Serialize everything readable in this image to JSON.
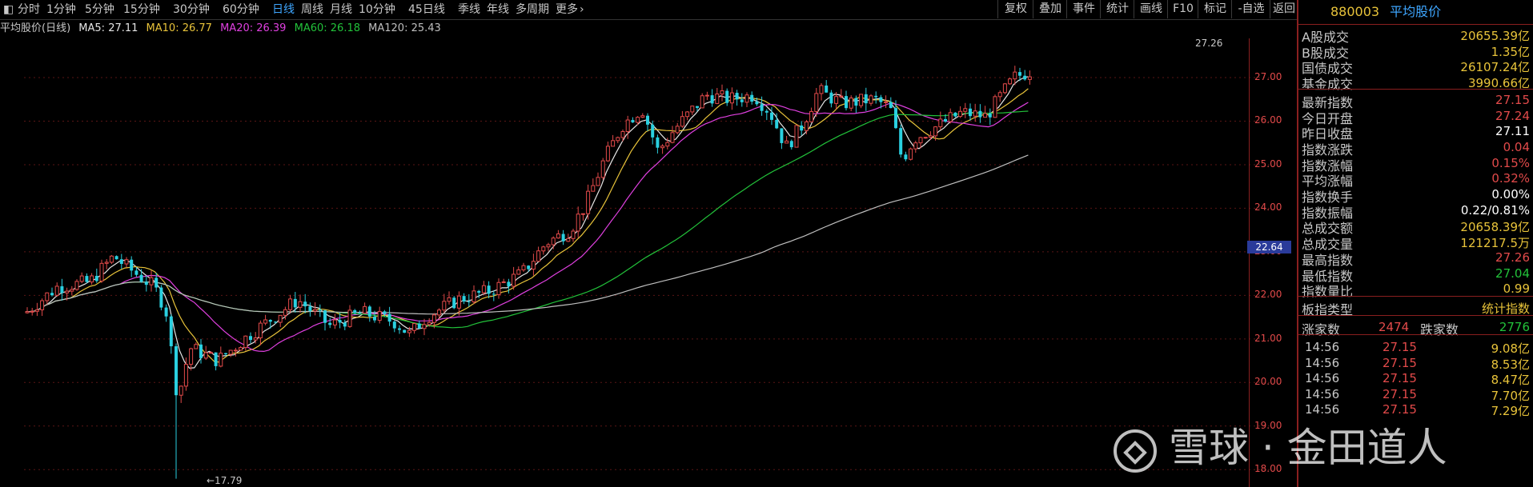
{
  "toolbar": {
    "periods": [
      "分时",
      "1分钟",
      "5分钟",
      "15分钟",
      "30分钟",
      "60分钟",
      "日线",
      "周线",
      "月线",
      "10分钟",
      "45日线",
      "季线",
      "年线",
      "多周期",
      "更多"
    ],
    "active_period": "日线",
    "buttons": [
      "复权",
      "叠加",
      "事件",
      "统计",
      "画线",
      "F10",
      "标记",
      "-自选",
      "返回"
    ]
  },
  "indicator_bar": {
    "title": "平均股价(日线)",
    "ma5": "MA5: 27.11",
    "ma10": "MA10: 26.77",
    "ma20": "MA20: 26.39",
    "ma60": "MA60: 26.18",
    "ma120": "MA120: 25.43"
  },
  "colors": {
    "up": "#e24a4a",
    "down": "#2ad0e0",
    "ma5": "#e6e6e6",
    "ma10": "#e8c33a",
    "ma20": "#e040e0",
    "ma60": "#22c23a",
    "ma120": "#bfbfbf",
    "accent": "#3ea6ff"
  },
  "chart": {
    "high_marker": "27.26",
    "low_marker": "←17.79",
    "current_price": "22.64"
  },
  "chart_data": {
    "type": "candlestick",
    "y_ticks": [
      "27.00",
      "26.00",
      "25.00",
      "24.00",
      "23.00",
      "22.00",
      "21.00",
      "20.00",
      "19.00",
      "18.00"
    ],
    "ylim": [
      17.6,
      27.9
    ],
    "high": 27.26,
    "low": 17.79
  },
  "panel": {
    "code": "880003",
    "name": "平均股价",
    "rows": [
      {
        "k": "A股成交",
        "v": "20655.39亿",
        "c": "#e8c33a"
      },
      {
        "k": "B股成交",
        "v": "1.35亿",
        "c": "#e8c33a"
      },
      {
        "k": "国债成交",
        "v": "26107.24亿",
        "c": "#e8c33a"
      },
      {
        "k": "基金成交",
        "v": "3990.66亿",
        "c": "#e8c33a"
      },
      {
        "k": "最新指数",
        "v": "27.15",
        "c": "#e24a4a"
      },
      {
        "k": "今日开盘",
        "v": "27.24",
        "c": "#e24a4a"
      },
      {
        "k": "昨日收盘",
        "v": "27.11",
        "c": "#ffffff"
      },
      {
        "k": "指数涨跌",
        "v": "0.04",
        "c": "#e24a4a"
      },
      {
        "k": "指数涨幅",
        "v": "0.15%",
        "c": "#e24a4a"
      },
      {
        "k": "平均涨幅",
        "v": "0.32%",
        "c": "#e24a4a"
      },
      {
        "k": "指数换手",
        "v": "0.00%",
        "c": "#ffffff"
      },
      {
        "k": "指数振幅",
        "v": "0.22/0.81%",
        "c": "#ffffff"
      },
      {
        "k": "总成交额",
        "v": "20658.39亿",
        "c": "#e8c33a"
      },
      {
        "k": "总成交量",
        "v": "121217.5万",
        "c": "#e8c33a"
      },
      {
        "k": "最高指数",
        "v": "27.26",
        "c": "#e24a4a"
      },
      {
        "k": "最低指数",
        "v": "27.04",
        "c": "#22c23a"
      },
      {
        "k": "指数量比",
        "v": "0.99",
        "c": "#e8c33a"
      }
    ],
    "board_type_label": "板指类型",
    "board_type_value": "统计指数",
    "up_label": "涨家数",
    "up_value": "2474",
    "down_label": "跌家数",
    "down_value": "2776",
    "ticks": [
      {
        "t": "14:56",
        "p": "27.15",
        "a": "9.08亿"
      },
      {
        "t": "14:56",
        "p": "27.15",
        "a": "8.53亿"
      },
      {
        "t": "14:56",
        "p": "27.15",
        "a": "8.47亿"
      },
      {
        "t": "14:56",
        "p": "27.15",
        "a": "7.70亿"
      },
      {
        "t": "14:56",
        "p": "27.15",
        "a": "7.29亿"
      }
    ]
  },
  "watermark": "雪球 · 金田道人"
}
